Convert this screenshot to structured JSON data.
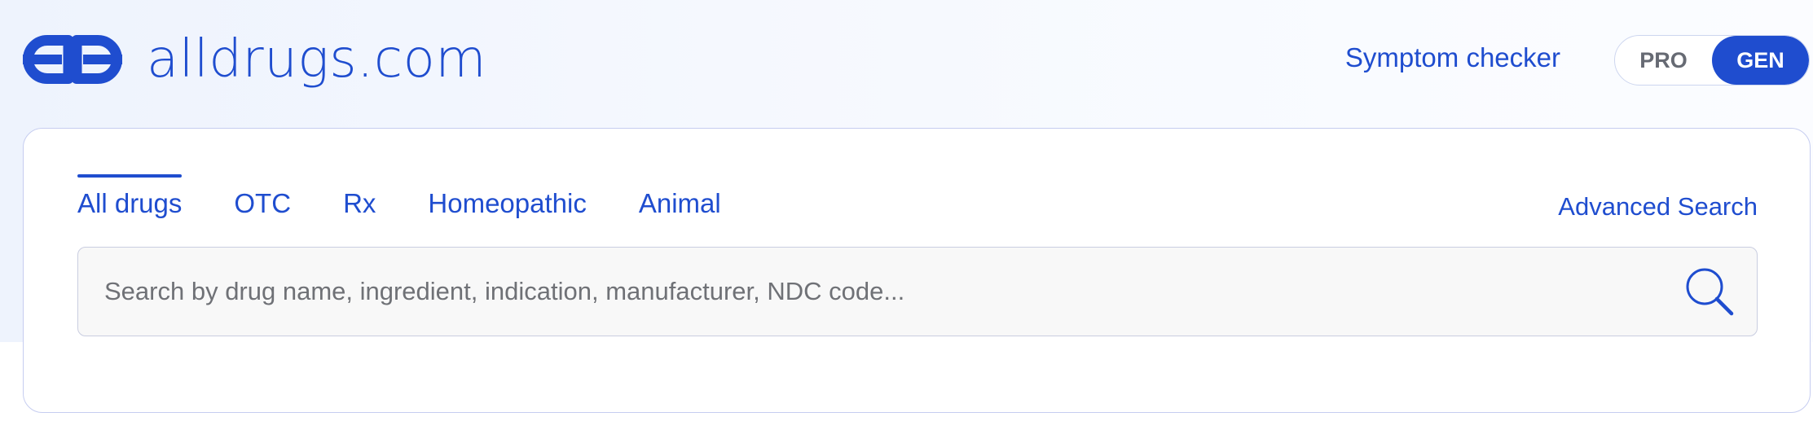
{
  "brand": {
    "name": "alldrugs.com",
    "color": "#1f4dcf"
  },
  "header": {
    "symptom_checker": "Symptom checker",
    "mode_toggle": {
      "options": [
        "PRO",
        "GEN"
      ],
      "selected": "GEN"
    }
  },
  "search": {
    "tabs": [
      {
        "label": "All drugs",
        "active": true
      },
      {
        "label": "OTC",
        "active": false
      },
      {
        "label": "Rx",
        "active": false
      },
      {
        "label": "Homeopathic",
        "active": false
      },
      {
        "label": "Animal",
        "active": false
      }
    ],
    "advanced_search": "Advanced Search",
    "placeholder": "Search by drug name, ingredient, indication, manufacturer, NDC code...",
    "value": "",
    "icon": "search-icon"
  },
  "icons": {
    "logo": "alldrugs-logo-icon",
    "search": "search-icon"
  }
}
